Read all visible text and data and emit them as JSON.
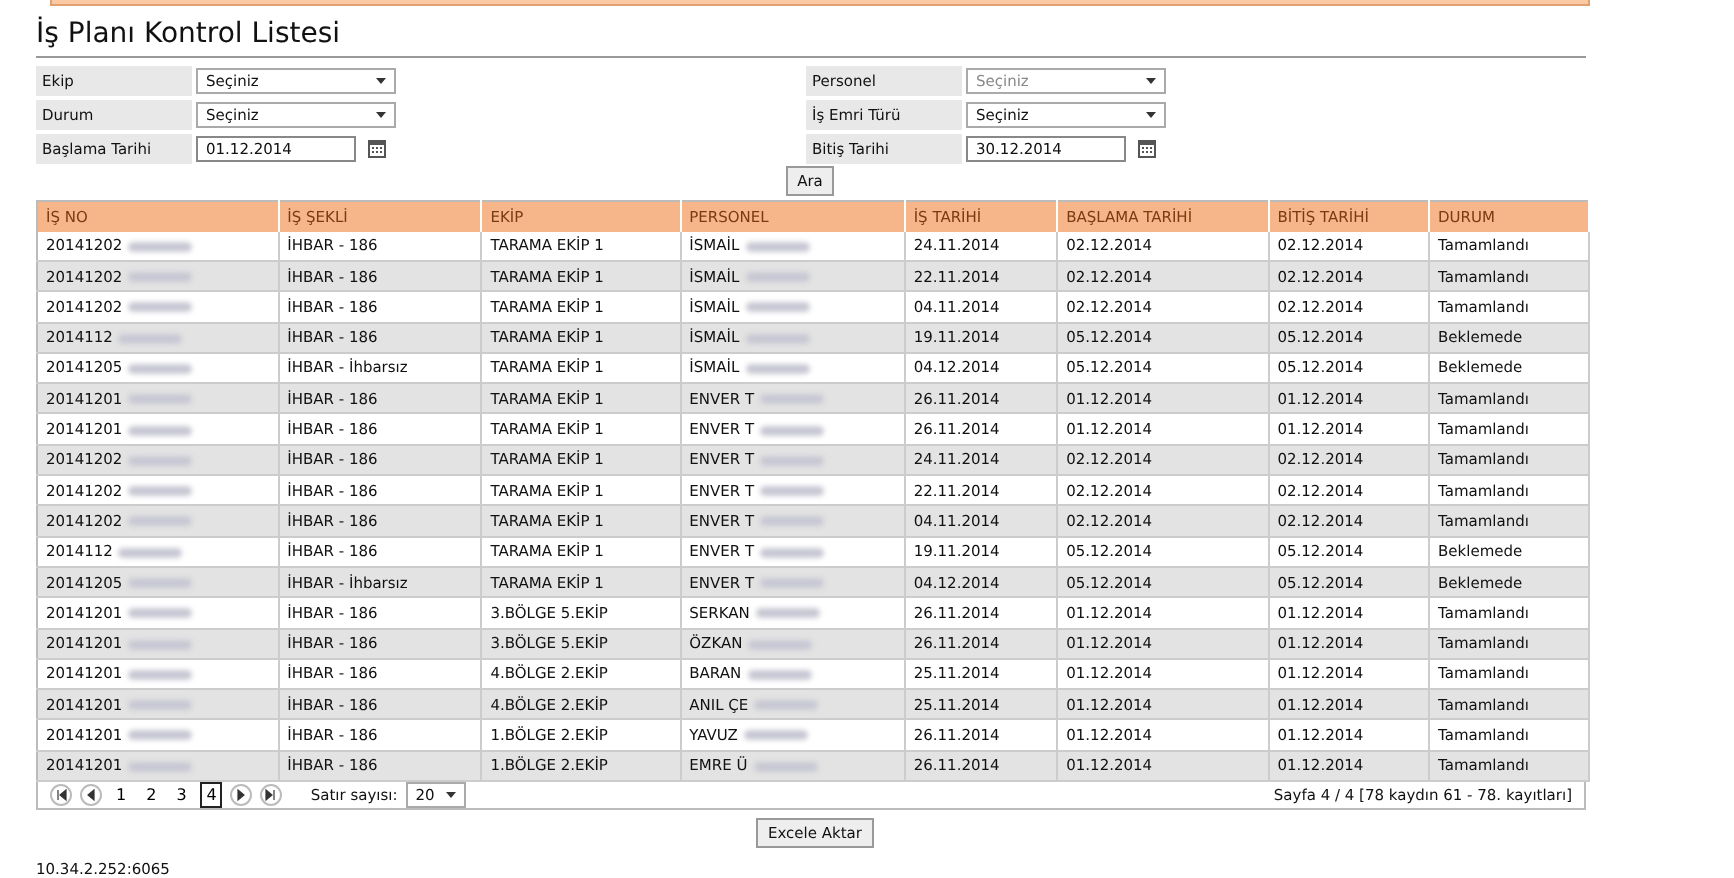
{
  "title": "İş Planı Kontrol Listesi",
  "filters": [
    {
      "label": "Ekip",
      "kind": "select",
      "value": "Seçiniz",
      "disabled": false
    },
    {
      "label": "Personel",
      "kind": "select",
      "value": "Seçiniz",
      "disabled": true
    },
    {
      "label": "Durum",
      "kind": "select",
      "value": "Seçiniz",
      "disabled": false
    },
    {
      "label": "İş Emri Türü",
      "kind": "select",
      "value": "Seçiniz",
      "disabled": false
    },
    {
      "label": "Başlama Tarihi",
      "kind": "date",
      "value": "01.12.2014",
      "disabled": false
    },
    {
      "label": "Bitiş Tarihi",
      "kind": "date",
      "value": "30.12.2014",
      "disabled": false
    }
  ],
  "search_button": "Ara",
  "table": {
    "columns": [
      "İŞ NO",
      "İŞ ŞEKLİ",
      "EKİP",
      "PERSONEL",
      "İŞ TARİHİ",
      "BAŞLAMA TARİHİ",
      "BİTİŞ TARİHİ",
      "DURUM"
    ],
    "rows": [
      [
        "20141202",
        "İHBAR - 186",
        "TARAMA EKİP 1",
        "İSMAİL",
        "24.11.2014",
        "02.12.2014",
        "02.12.2014",
        "Tamamlandı"
      ],
      [
        "20141202",
        "İHBAR - 186",
        "TARAMA EKİP 1",
        "İSMAİL",
        "22.11.2014",
        "02.12.2014",
        "02.12.2014",
        "Tamamlandı"
      ],
      [
        "20141202",
        "İHBAR - 186",
        "TARAMA EKİP 1",
        "İSMAİL",
        "04.11.2014",
        "02.12.2014",
        "02.12.2014",
        "Tamamlandı"
      ],
      [
        "2014112",
        "İHBAR - 186",
        "TARAMA EKİP 1",
        "İSMAİL",
        "19.11.2014",
        "05.12.2014",
        "05.12.2014",
        "Beklemede"
      ],
      [
        "20141205",
        "İHBAR - İhbarsız",
        "TARAMA EKİP 1",
        "İSMAİL",
        "04.12.2014",
        "05.12.2014",
        "05.12.2014",
        "Beklemede"
      ],
      [
        "20141201",
        "İHBAR - 186",
        "TARAMA EKİP 1",
        "ENVER T",
        "26.11.2014",
        "01.12.2014",
        "01.12.2014",
        "Tamamlandı"
      ],
      [
        "20141201",
        "İHBAR - 186",
        "TARAMA EKİP 1",
        "ENVER T",
        "26.11.2014",
        "01.12.2014",
        "01.12.2014",
        "Tamamlandı"
      ],
      [
        "20141202",
        "İHBAR - 186",
        "TARAMA EKİP 1",
        "ENVER T",
        "24.11.2014",
        "02.12.2014",
        "02.12.2014",
        "Tamamlandı"
      ],
      [
        "20141202",
        "İHBAR - 186",
        "TARAMA EKİP 1",
        "ENVER T",
        "22.11.2014",
        "02.12.2014",
        "02.12.2014",
        "Tamamlandı"
      ],
      [
        "20141202",
        "İHBAR - 186",
        "TARAMA EKİP 1",
        "ENVER T",
        "04.11.2014",
        "02.12.2014",
        "02.12.2014",
        "Tamamlandı"
      ],
      [
        "2014112",
        "İHBAR - 186",
        "TARAMA EKİP 1",
        "ENVER T",
        "19.11.2014",
        "05.12.2014",
        "05.12.2014",
        "Beklemede"
      ],
      [
        "20141205",
        "İHBAR - İhbarsız",
        "TARAMA EKİP 1",
        "ENVER T",
        "04.12.2014",
        "05.12.2014",
        "05.12.2014",
        "Beklemede"
      ],
      [
        "20141201",
        "İHBAR - 186",
        "3.BÖLGE 5.EKİP",
        "SERKAN",
        "26.11.2014",
        "01.12.2014",
        "01.12.2014",
        "Tamamlandı"
      ],
      [
        "20141201",
        "İHBAR - 186",
        "3.BÖLGE 5.EKİP",
        "ÖZKAN",
        "26.11.2014",
        "01.12.2014",
        "01.12.2014",
        "Tamamlandı"
      ],
      [
        "20141201",
        "İHBAR - 186",
        "4.BÖLGE 2.EKİP",
        "BARAN",
        "25.11.2014",
        "01.12.2014",
        "01.12.2014",
        "Tamamlandı"
      ],
      [
        "20141201",
        "İHBAR - 186",
        "4.BÖLGE 2.EKİP",
        "ANIL ÇE",
        "25.11.2014",
        "01.12.2014",
        "01.12.2014",
        "Tamamlandı"
      ],
      [
        "20141201",
        "İHBAR - 186",
        "1.BÖLGE 2.EKİP",
        "YAVUZ",
        "26.11.2014",
        "01.12.2014",
        "01.12.2014",
        "Tamamlandı"
      ],
      [
        "20141201",
        "İHBAR - 186",
        "1.BÖLGE 2.EKİP",
        "EMRE Ü",
        "26.11.2014",
        "01.12.2014",
        "01.12.2014",
        "Tamamlandı"
      ]
    ]
  },
  "pager": {
    "pages": [
      {
        "label": "1",
        "selected": false
      },
      {
        "label": "2",
        "selected": false
      },
      {
        "label": "3",
        "selected": false
      },
      {
        "label": "4",
        "selected": true
      }
    ],
    "rows_label": "Satır sayısı:",
    "rows_value": "20",
    "summary": "Sayfa 4 / 4 [78 kaydın 61 - 78. kayıtları]"
  },
  "export_button": "Excele Aktar",
  "footer": "10.34.2.252:6065"
}
